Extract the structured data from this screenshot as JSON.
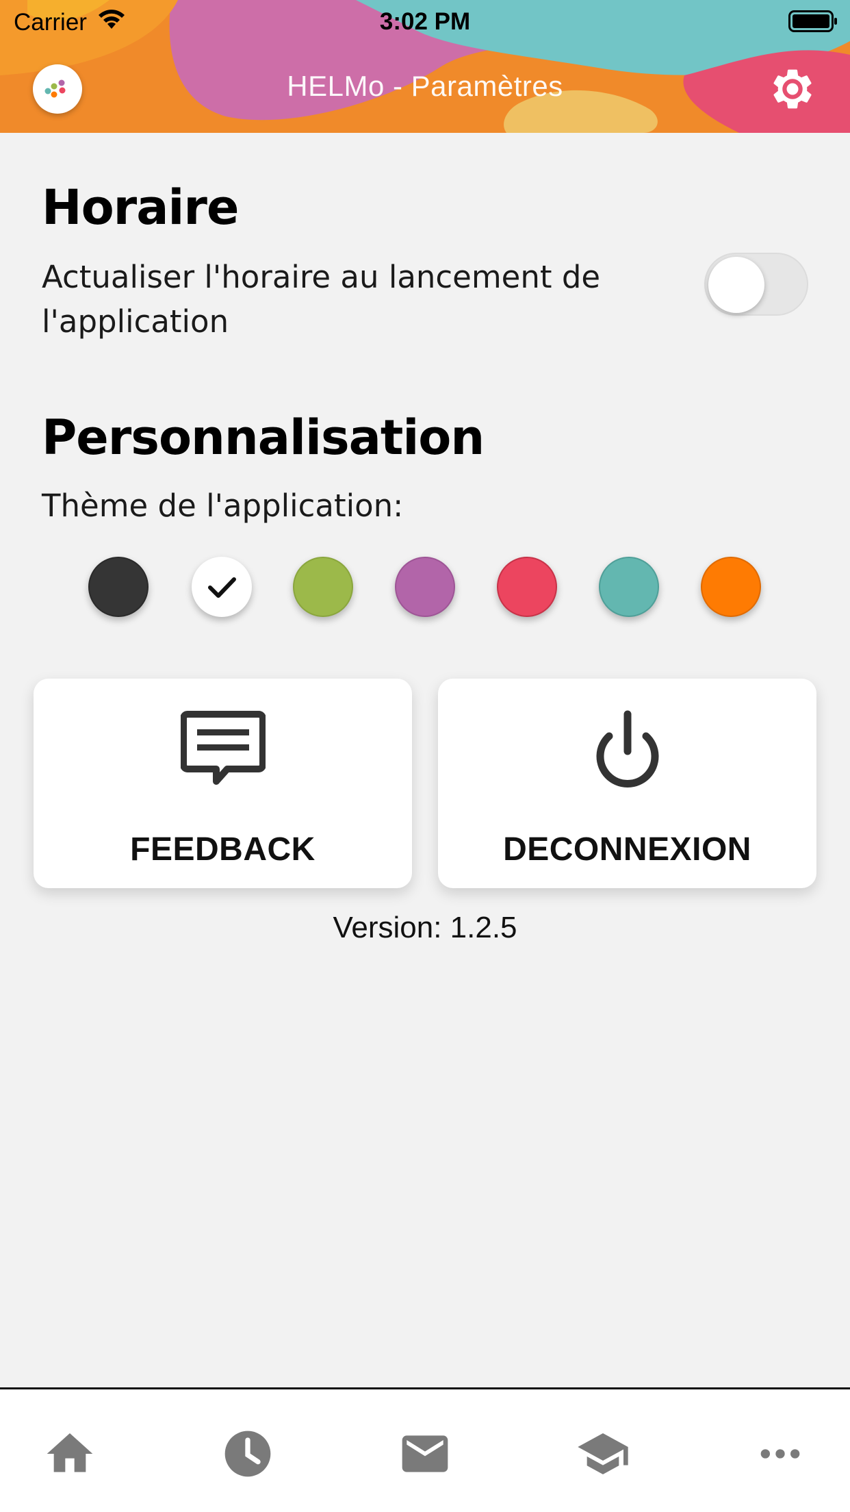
{
  "status_bar": {
    "carrier": "Carrier",
    "time": "3:02 PM"
  },
  "header": {
    "title": "HELMo -  Paramètres",
    "logo_icon": "helmo-logo-icon",
    "settings_icon": "gear-icon"
  },
  "schedule": {
    "title": "Horaire",
    "option_label_line1": "Actualiser l'horaire au lancement de",
    "option_label_line2": "l'application",
    "refresh_on_launch": false
  },
  "personalisation": {
    "title": "Personnalisation",
    "theme_label": "Thème de l'application:",
    "themes": [
      {
        "name": "dark",
        "color": "#353535",
        "selected": false
      },
      {
        "name": "white",
        "color": "#ffffff",
        "selected": true
      },
      {
        "name": "green",
        "color": "#9cb94a",
        "selected": false
      },
      {
        "name": "purple",
        "color": "#b265a9",
        "selected": false
      },
      {
        "name": "red",
        "color": "#ec455f",
        "selected": false
      },
      {
        "name": "teal",
        "color": "#63b7b0",
        "selected": false
      },
      {
        "name": "orange",
        "color": "#fe7b03",
        "selected": false
      }
    ]
  },
  "actions": {
    "feedback_label": "FEEDBACK",
    "feedback_icon": "feedback-icon",
    "logout_label": "DECONNEXION",
    "logout_icon": "power-icon"
  },
  "version": "Version: 1.2.5",
  "tabbar": {
    "items": [
      {
        "name": "home",
        "icon": "home-icon"
      },
      {
        "name": "schedule",
        "icon": "clock-icon"
      },
      {
        "name": "mail",
        "icon": "mail-icon"
      },
      {
        "name": "courses",
        "icon": "graduation-cap-icon"
      },
      {
        "name": "more",
        "icon": "more-icon"
      }
    ]
  },
  "colors": {
    "background": "#f2f2f2",
    "tab_icon": "#7a7a7a",
    "action_icon": "#333333"
  }
}
